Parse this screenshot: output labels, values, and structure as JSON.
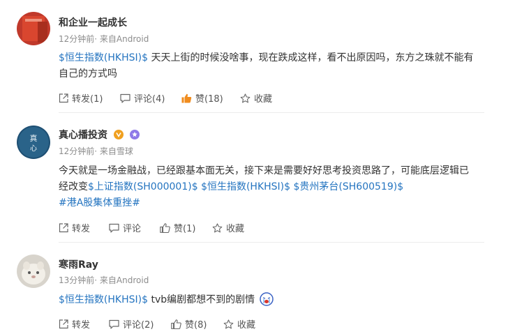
{
  "posts": [
    {
      "author": "和企业一起成长",
      "time": "12分钟前",
      "source": "来自Android",
      "content": {
        "tag1": "$恒生指数(HKHSI)$",
        "text1": " 天天上街的时候没啥事，现在跌成这样，看不出原因吗，东方之珠就不能有自己的方式吗"
      },
      "actions": {
        "repost": "转发(1)",
        "comment": "评论(4)",
        "like": "赞(18)",
        "favorite": "收藏"
      }
    },
    {
      "author": "真心播投资",
      "time": "12分钟前",
      "source": "来自雪球",
      "content": {
        "text1": "今天就是一场金融战，已经跟基本面无关，接下来是需要好好思考投资思路了，可能底层逻辑已经改变",
        "tag1": "$上证指数(SH000001)$",
        "tag2": "$恒生指数(HKHSI)$",
        "tag3": "$贵州茅台(SH600519)$",
        "tag4": "#港A股集体重挫#"
      },
      "actions": {
        "repost": "转发",
        "comment": "评论",
        "like": "赞(1)",
        "favorite": "收藏"
      }
    },
    {
      "author": "寒雨Ray",
      "time": "13分钟前",
      "source": "来自Android",
      "content": {
        "tag1": "$恒生指数(HKHSI)$",
        "text1": " tvb编剧都想不到的剧情"
      },
      "actions": {
        "repost": "转发",
        "comment": "评论(2)",
        "like": "赞(8)",
        "favorite": "收藏"
      }
    }
  ],
  "colors": {
    "link": "#2474c0",
    "like_active": "#f08c1e",
    "meta": "#8c8c8c"
  },
  "icons": {
    "repost": "share-icon",
    "comment": "comment-icon",
    "like": "thumbs-up-icon",
    "favorite": "star-icon"
  }
}
